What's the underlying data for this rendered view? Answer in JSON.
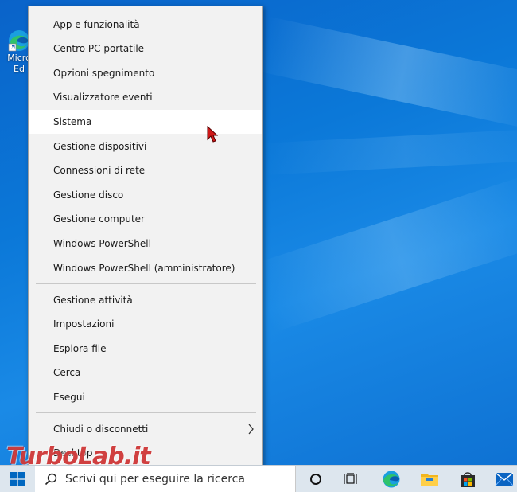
{
  "desktop": {
    "icon_label_line1": "Micro",
    "icon_label_line2": "Ed",
    "icon": "edge-desktop-shortcut-icon"
  },
  "menu": {
    "group1": [
      {
        "label": "App e funzionalità"
      },
      {
        "label": "Centro PC portatile"
      },
      {
        "label": "Opzioni spegnimento"
      },
      {
        "label": "Visualizzatore eventi"
      },
      {
        "label": "Sistema"
      },
      {
        "label": "Gestione dispositivi"
      },
      {
        "label": "Connessioni di rete"
      },
      {
        "label": "Gestione disco"
      },
      {
        "label": "Gestione computer"
      },
      {
        "label": "Windows PowerShell"
      },
      {
        "label": "Windows PowerShell (amministratore)"
      }
    ],
    "group2": [
      {
        "label": "Gestione attività"
      },
      {
        "label": "Impostazioni"
      },
      {
        "label": "Esplora file"
      },
      {
        "label": "Cerca"
      },
      {
        "label": "Esegui"
      }
    ],
    "group3": [
      {
        "label": "Chiudi o disconnetti"
      },
      {
        "label": "Desktop"
      }
    ],
    "hovered_item": "Sistema"
  },
  "taskbar": {
    "search_placeholder": "Scrivi qui per eseguire la ricerca"
  },
  "watermark": {
    "text": "TurboLab.it"
  },
  "colors": {
    "menu_bg": "#f2f2f2",
    "menu_hover": "#ffffff",
    "desktop_blue": "#0b78d8",
    "taskbar_bg": "#dde6ee",
    "watermark_red": "#c81e1e"
  }
}
